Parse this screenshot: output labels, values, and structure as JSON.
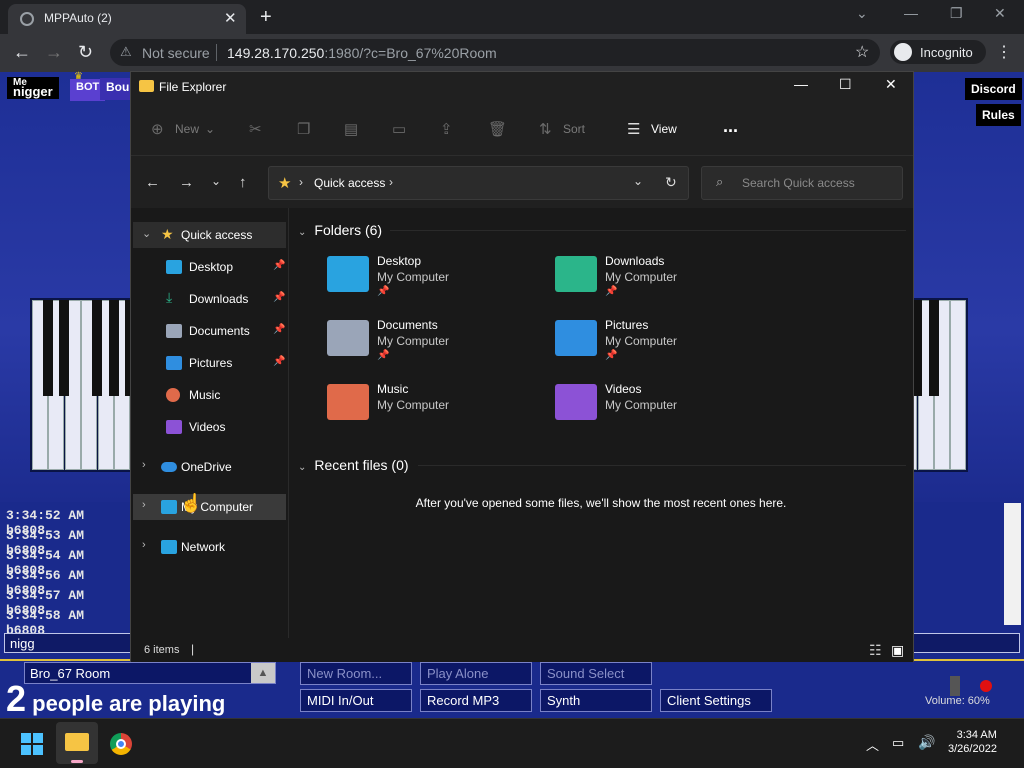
{
  "browser": {
    "tab_title": "MPPAuto (2)",
    "security": "Not secure",
    "url_host": "149.28.170.250",
    "url_rest": ":1980/?c=Bro_67%20Room",
    "profile": "Incognito"
  },
  "page": {
    "names": [
      {
        "label": "Me\nnigger",
        "bg": "#000000"
      },
      {
        "label": "BOT",
        "bg": "#5a40d0"
      },
      {
        "label": "Bou",
        "bg": "#3a2fb0"
      }
    ],
    "right_buttons": [
      "Discord",
      "Rules"
    ],
    "chat": [
      "3:34:52 AM  b6808",
      "3:34:53 AM  b6808",
      "3:34:54 AM  b6808",
      "3:34:56 AM  b6808",
      "3:34:57 AM  b6808",
      "3:34:58 AM  b6808"
    ],
    "chat_input": "nigg",
    "room": "Bro_67 Room",
    "players_count": "2",
    "players_text": "people are playing",
    "controls": [
      "New Room...",
      "Play Alone",
      "Sound Select",
      "MIDI In/Out",
      "Record MP3",
      "Synth",
      "Client Settings"
    ],
    "volume": "Volume: 60%"
  },
  "explorer": {
    "title": "File Explorer",
    "cmd": {
      "new": "New",
      "sort": "Sort",
      "view": "View",
      "more": "..."
    },
    "address": "Quick access",
    "search_placeholder": "Search Quick access",
    "nav": {
      "quick_access": "Quick access",
      "desktop": "Desktop",
      "downloads": "Downloads",
      "documents": "Documents",
      "pictures": "Pictures",
      "music": "Music",
      "videos": "Videos",
      "onedrive": "OneDrive",
      "my_computer": "My Computer",
      "network": "Network"
    },
    "folders_header": "Folders (6)",
    "folders": [
      {
        "name": "Desktop",
        "location": "My Computer",
        "pinned": true,
        "color": "#29a3e0"
      },
      {
        "name": "Downloads",
        "location": "My Computer",
        "pinned": true,
        "color": "#2bb58a"
      },
      {
        "name": "Documents",
        "location": "My Computer",
        "pinned": true,
        "color": "#9aa5b8"
      },
      {
        "name": "Pictures",
        "location": "My Computer",
        "pinned": true,
        "color": "#2f8ee0"
      },
      {
        "name": "Music",
        "location": "My Computer",
        "pinned": false,
        "color": "#e06a4a"
      },
      {
        "name": "Videos",
        "location": "My Computer",
        "pinned": false,
        "color": "#8c52d6"
      }
    ],
    "recent_header": "Recent files (0)",
    "recent_empty": "After you've opened some files, we'll show the most recent ones here.",
    "status": "6 items"
  },
  "taskbar": {
    "time": "3:34 AM",
    "date": "3/26/2022"
  }
}
